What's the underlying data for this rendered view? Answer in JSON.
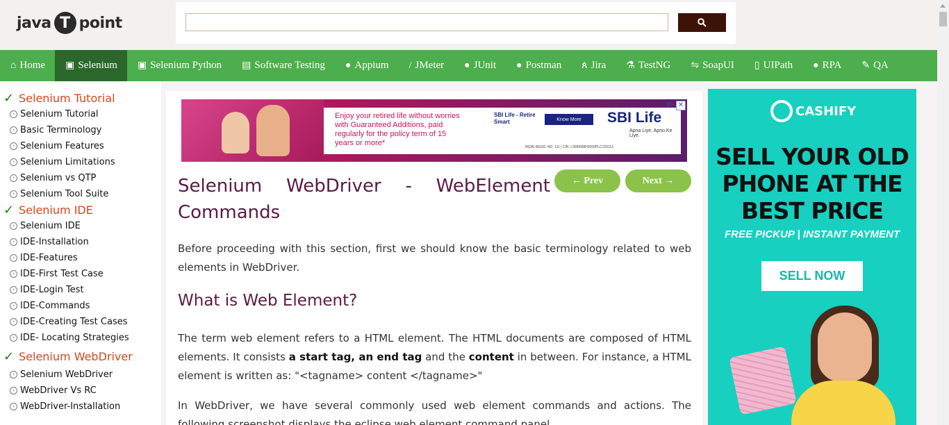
{
  "header": {
    "logo": {
      "left": "java",
      "badge": "T",
      "right": "point"
    },
    "search": {
      "placeholder": "",
      "button_icon": "search-icon"
    }
  },
  "nav": {
    "items": [
      {
        "label": "Home",
        "icon": "home-icon"
      },
      {
        "label": "Selenium",
        "icon": "selenium-icon",
        "active": true
      },
      {
        "label": "Selenium Python",
        "icon": "selenium-icon"
      },
      {
        "label": "Software Testing",
        "icon": "testing-icon"
      },
      {
        "label": "Appium",
        "icon": "appium-icon"
      },
      {
        "label": "JMeter",
        "icon": "feather-icon"
      },
      {
        "label": "JUnit",
        "icon": "junit-icon"
      },
      {
        "label": "Postman",
        "icon": "postman-icon"
      },
      {
        "label": "Jira",
        "icon": "jira-icon"
      },
      {
        "label": "TestNG",
        "icon": "testng-icon"
      },
      {
        "label": "SoapUI",
        "icon": "soapui-icon"
      },
      {
        "label": "UIPath",
        "icon": "uipath-icon"
      },
      {
        "label": "RPA",
        "icon": "rpa-icon"
      },
      {
        "label": "QA",
        "icon": "qa-icon"
      }
    ]
  },
  "sidebar": {
    "sections": [
      {
        "title": "Selenium Tutorial",
        "items": [
          "Selenium Tutorial",
          "Basic Terminology",
          "Selenium Features",
          "Selenium Limitations",
          "Selenium vs QTP",
          "Selenium Tool Suite"
        ]
      },
      {
        "title": "Selenium IDE",
        "items": [
          "Selenium IDE",
          "IDE-Installation",
          "IDE-Features",
          "IDE-First Test Case",
          "IDE-Login Test",
          "IDE-Commands",
          "IDE-Creating Test Cases",
          "IDE- Locating Strategies"
        ]
      },
      {
        "title": "Selenium WebDriver",
        "items": [
          "Selenium WebDriver",
          "WebDriver Vs RC",
          "WebDriver-Installation"
        ]
      }
    ]
  },
  "ad_top": {
    "message": "Enjoy your retired life without worries with Guaranteed Additions, paid regularly for the policy term of 15 years or more*",
    "product": "SBI Life - Retire Smart",
    "cta": "Know More",
    "brand": "SBI Life",
    "tagline": "Apna Liye, Apno Ke Liye.",
    "fineprint": "IRDAI REGD. NO. 111 | CIN: L99999MH2000PLC129113"
  },
  "main": {
    "title": "Selenium WebDriver - WebElement Commands",
    "prev_label": "← Prev",
    "next_label": "Next →",
    "intro": "Before proceeding with this section, first we should know the basic terminology related to web elements in WebDriver.",
    "h2": "What is Web Element?",
    "p2_a": "The term web element refers to a HTML element. The HTML documents are composed of HTML elements. It consists ",
    "p2_b1": "a start tag, an end tag",
    "p2_c": " and the ",
    "p2_b2": "content",
    "p2_d": " in between. For instance, a HTML element is written as: \"<tagname> content </tagname>\"",
    "p3": "In WebDriver, we have several commonly used web element commands and actions. The following screenshot displays the eclipse web element command panel."
  },
  "ad_right": {
    "brand": "CASHIFY",
    "headline": "SELL YOUR OLD PHONE AT THE BEST PRICE",
    "sub": "FREE PICKUP | INSTANT PAYMENT",
    "cta": "SELL NOW"
  }
}
